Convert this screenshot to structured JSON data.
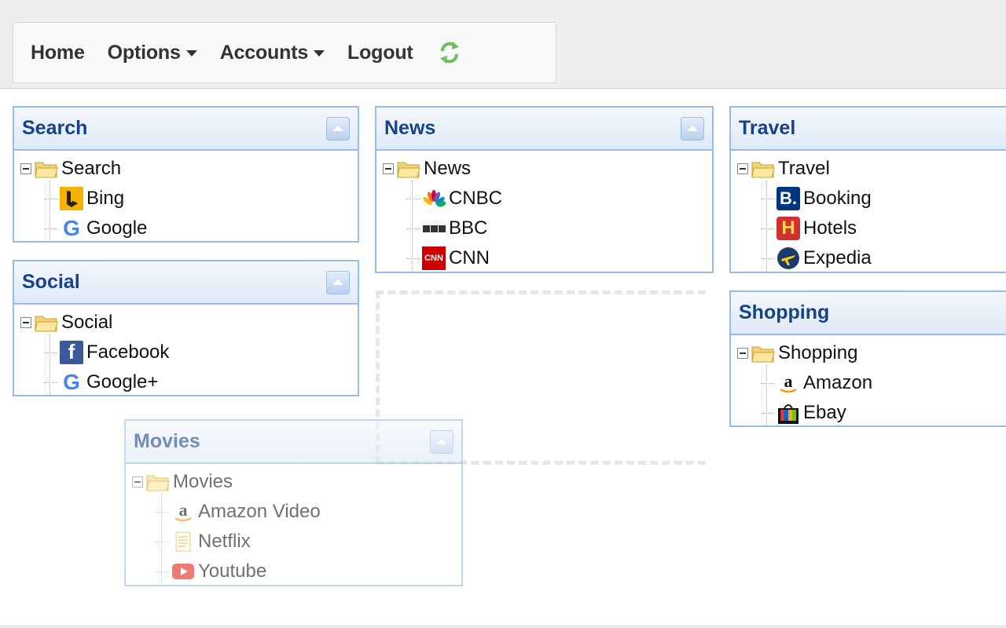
{
  "nav": {
    "home": "Home",
    "options": "Options",
    "accounts": "Accounts",
    "logout": "Logout",
    "refresh_icon": "refresh-icon"
  },
  "panels": {
    "search": {
      "title": "Search",
      "root": "Search",
      "items": [
        "Bing",
        "Google"
      ]
    },
    "social": {
      "title": "Social",
      "root": "Social",
      "items": [
        "Facebook",
        "Google+"
      ]
    },
    "news": {
      "title": "News",
      "root": "News",
      "items": [
        "CNBC",
        "BBC",
        "CNN"
      ]
    },
    "travel": {
      "title": "Travel",
      "root": "Travel",
      "items": [
        "Booking",
        "Hotels",
        "Expedia"
      ]
    },
    "shopping": {
      "title": "Shopping",
      "root": "Shopping",
      "items": [
        "Amazon",
        "Ebay"
      ]
    },
    "movies": {
      "title": "Movies",
      "root": "Movies",
      "items": [
        "Amazon Video",
        "Netflix",
        "Youtube"
      ]
    }
  },
  "colors": {
    "panel_border": "#99bbe8",
    "panel_title": "#15428b",
    "accent_green": "#5cb85c"
  }
}
